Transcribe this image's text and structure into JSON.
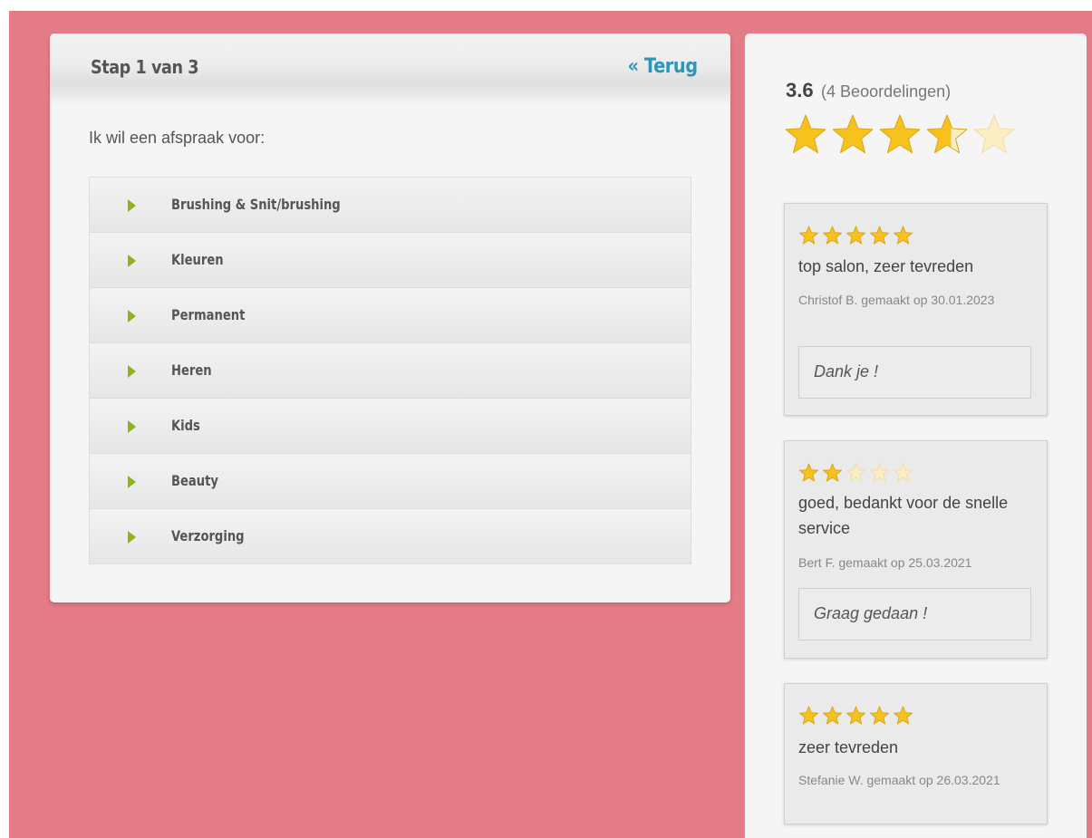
{
  "booking": {
    "step_title": "Stap 1 van 3",
    "back_link": "« Terug",
    "intro": "Ik wil een afspraak voor:",
    "services": [
      {
        "label": "Brushing & Snit/brushing"
      },
      {
        "label": "Kleuren"
      },
      {
        "label": "Permanent"
      },
      {
        "label": "Heren"
      },
      {
        "label": "Kids"
      },
      {
        "label": "Beauty"
      },
      {
        "label": "Verzorging"
      }
    ]
  },
  "rating_summary": {
    "score": "3.6",
    "count_text": "(4 Beoordelingen)",
    "stars": 3.6
  },
  "reviews": [
    {
      "stars": 5,
      "title": "top salon, zeer tevreden",
      "meta": "Christof B. gemaakt op 30.01.2023",
      "reply": "Dank je !"
    },
    {
      "stars": 2,
      "title": "goed, bedankt voor de snelle service",
      "meta": "Bert F. gemaakt op 25.03.2021",
      "reply": "Graag gedaan !"
    },
    {
      "stars": 5,
      "title": "zeer tevreden",
      "meta": "Stefanie W. gemaakt op 26.03.2021",
      "reply": ""
    }
  ],
  "colors": {
    "page_bg": "#e37c86",
    "card_bg": "#f5f5f5",
    "accent_link": "#2e95b8",
    "arrow_green": "#8cb41c",
    "star_gold": "#f7c21e"
  },
  "icons": {
    "service_arrow": "triangle-right-icon",
    "rating": "star-icon"
  }
}
